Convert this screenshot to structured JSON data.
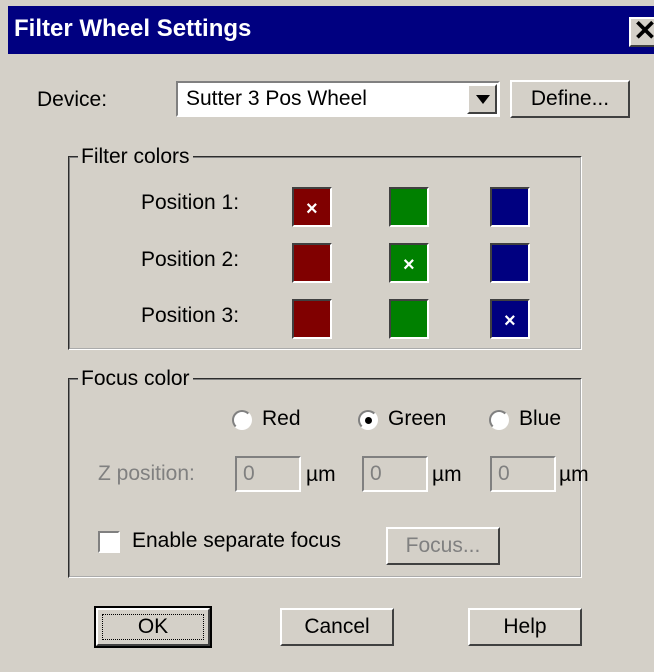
{
  "window": {
    "title": "Filter Wheel Settings",
    "close_glyph": "✕"
  },
  "device": {
    "label": "Device:",
    "selected": "Sutter 3 Pos Wheel",
    "define_label": "Define..."
  },
  "filter_colors": {
    "legend": "Filter colors",
    "rows": [
      {
        "label": "Position 1:",
        "selected_index": 0
      },
      {
        "label": "Position 2:",
        "selected_index": 1
      },
      {
        "label": "Position 3:",
        "selected_index": 2
      }
    ],
    "swatch_colors": [
      "#800000",
      "#008000",
      "#000080"
    ],
    "mark": "×"
  },
  "focus_color": {
    "legend": "Focus color",
    "options": [
      "Red",
      "Green",
      "Blue"
    ],
    "selected": "Green",
    "z_label": "Z position:",
    "z_values": [
      "0",
      "0",
      "0"
    ],
    "unit": "µm",
    "enable_label": "Enable separate focus",
    "enable_checked": false,
    "focus_button": "Focus..."
  },
  "buttons": {
    "ok": "OK",
    "cancel": "Cancel",
    "help": "Help"
  }
}
